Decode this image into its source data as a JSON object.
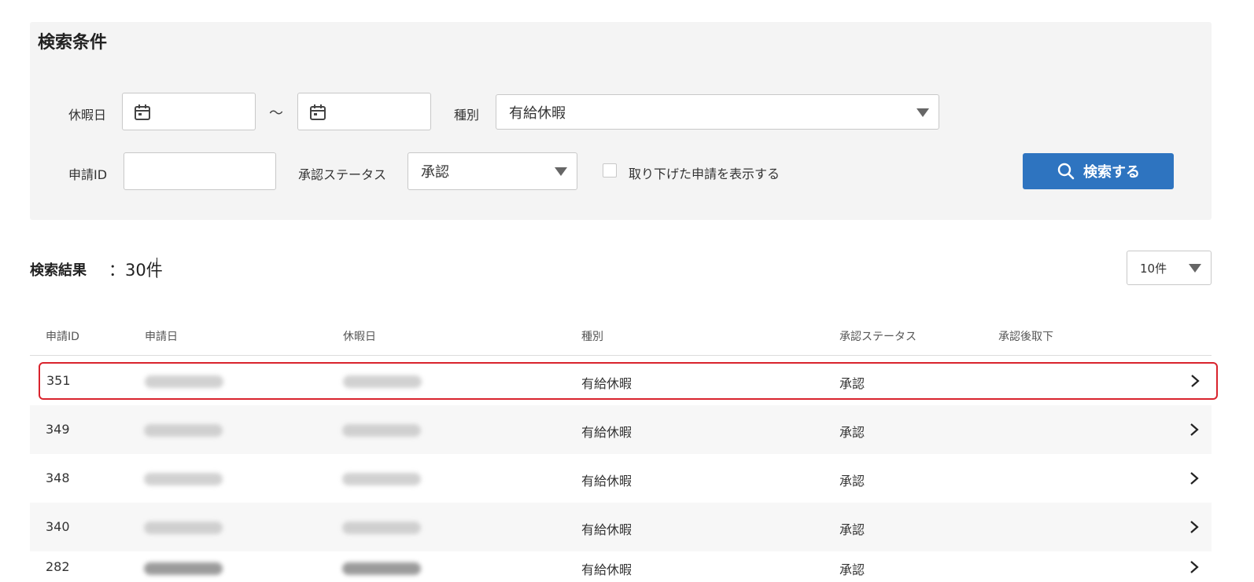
{
  "search_panel": {
    "title": "検索条件",
    "holiday_label": "休暇日",
    "range_sep": "～",
    "type_label": "種別",
    "type_value": "有給休暇",
    "app_id_label": "申請ID",
    "app_id_value": "",
    "status_label": "承認ステータス",
    "status_value": "承認",
    "show_withdrawn_label": "取り下げた申請を表示する",
    "show_withdrawn_checked": false,
    "search_button": "検索する"
  },
  "results": {
    "title": "検索結果",
    "count": "：30件",
    "per_page": "10件",
    "columns": [
      "申請ID",
      "申請日",
      "休暇日",
      "種別",
      "承認ステータス",
      "承認後取下"
    ],
    "rows": [
      {
        "id": "351",
        "type": "有給休暇",
        "status": "承認"
      },
      {
        "id": "349",
        "type": "有給休暇",
        "status": "承認"
      },
      {
        "id": "348",
        "type": "有給休暇",
        "status": "承認"
      },
      {
        "id": "340",
        "type": "有給休暇",
        "status": "承認"
      },
      {
        "id": "282",
        "type": "有給休暇",
        "status": "承認"
      }
    ]
  },
  "colors": {
    "primary": "#2e74c0",
    "highlight_border": "#d9232d",
    "panel_bg": "#f4f4f4"
  }
}
